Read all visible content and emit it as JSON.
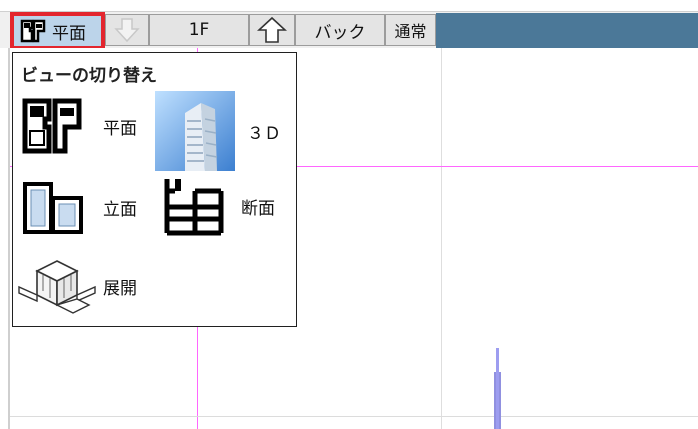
{
  "toolbar": {
    "view_button_label": "平面",
    "floor_label": "1F",
    "back_label": "バック",
    "mode_label": "通常"
  },
  "view_menu": {
    "title": "ビューの切り替え",
    "items": [
      {
        "label": "平面",
        "icon": "floor-plan-icon"
      },
      {
        "label": "３Ｄ",
        "icon": "3d-building-icon"
      },
      {
        "label": "立面",
        "icon": "elevation-icon"
      },
      {
        "label": "断面",
        "icon": "section-icon"
      },
      {
        "label": "展開",
        "icon": "development-icon"
      }
    ]
  },
  "colors": {
    "highlight_border": "#e3262e",
    "selected_button_bg": "#bcd4ea",
    "toolbar_blue": "#4b7898",
    "grid_line": "#ff66ff",
    "post_color": "#9d9df0"
  }
}
